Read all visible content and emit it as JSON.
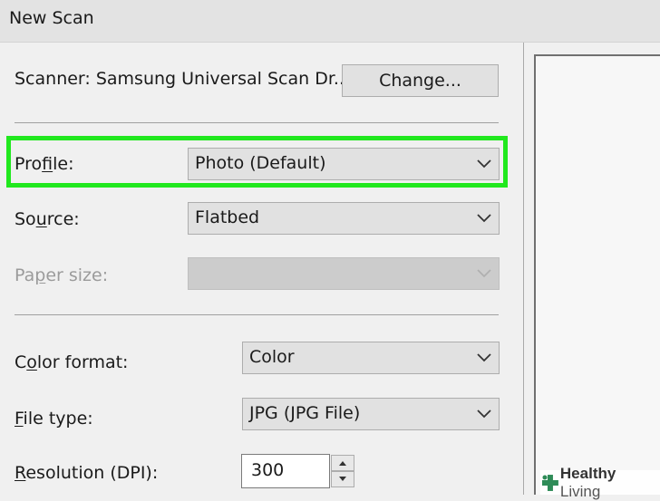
{
  "window": {
    "title": "New Scan"
  },
  "scanner": {
    "label": "Scanner: Samsung Universal Scan Dr...",
    "change_button": "Change..."
  },
  "profile": {
    "label_pre": "Pro",
    "label_key": "f",
    "label_post": "ile:",
    "value": "Photo (Default)"
  },
  "source": {
    "label_pre": "So",
    "label_key": "u",
    "label_post": "rce:",
    "value": "Flatbed"
  },
  "paper_size": {
    "label_pre": "Pa",
    "label_key": "p",
    "label_post": "er size:",
    "value": ""
  },
  "color_format": {
    "label_pre": "C",
    "label_key": "o",
    "label_post": "lor format:",
    "value": "Color"
  },
  "file_type": {
    "label_key": "F",
    "label_post": "ile type:",
    "value": "JPG (JPG File)"
  },
  "resolution": {
    "label_key": "R",
    "label_post": "esolution (DPI):",
    "value": "300"
  },
  "watermark": {
    "brand_bold": "Healthy",
    "brand_light": " Living"
  },
  "colors": {
    "highlight": "#21e81e",
    "disabled_text": "#9b9b9b"
  }
}
